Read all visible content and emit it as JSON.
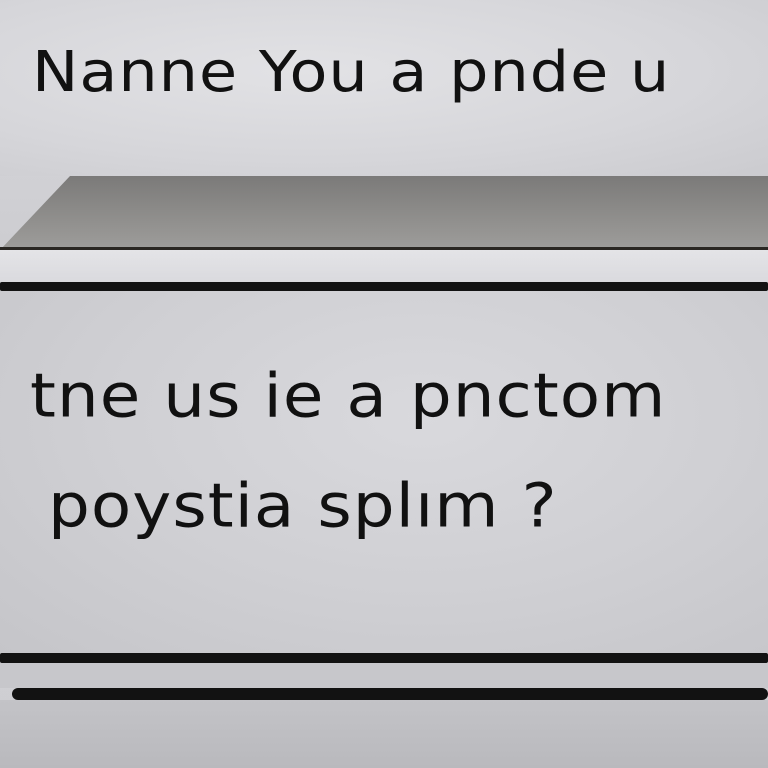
{
  "heading": "Nanne You a pnde u",
  "body": {
    "line1": "tne us ie a pnctom",
    "line2": "poystia splım ?"
  },
  "colors": {
    "text": "#111111",
    "panel": "#d3d3d7",
    "rule": "#121212"
  }
}
